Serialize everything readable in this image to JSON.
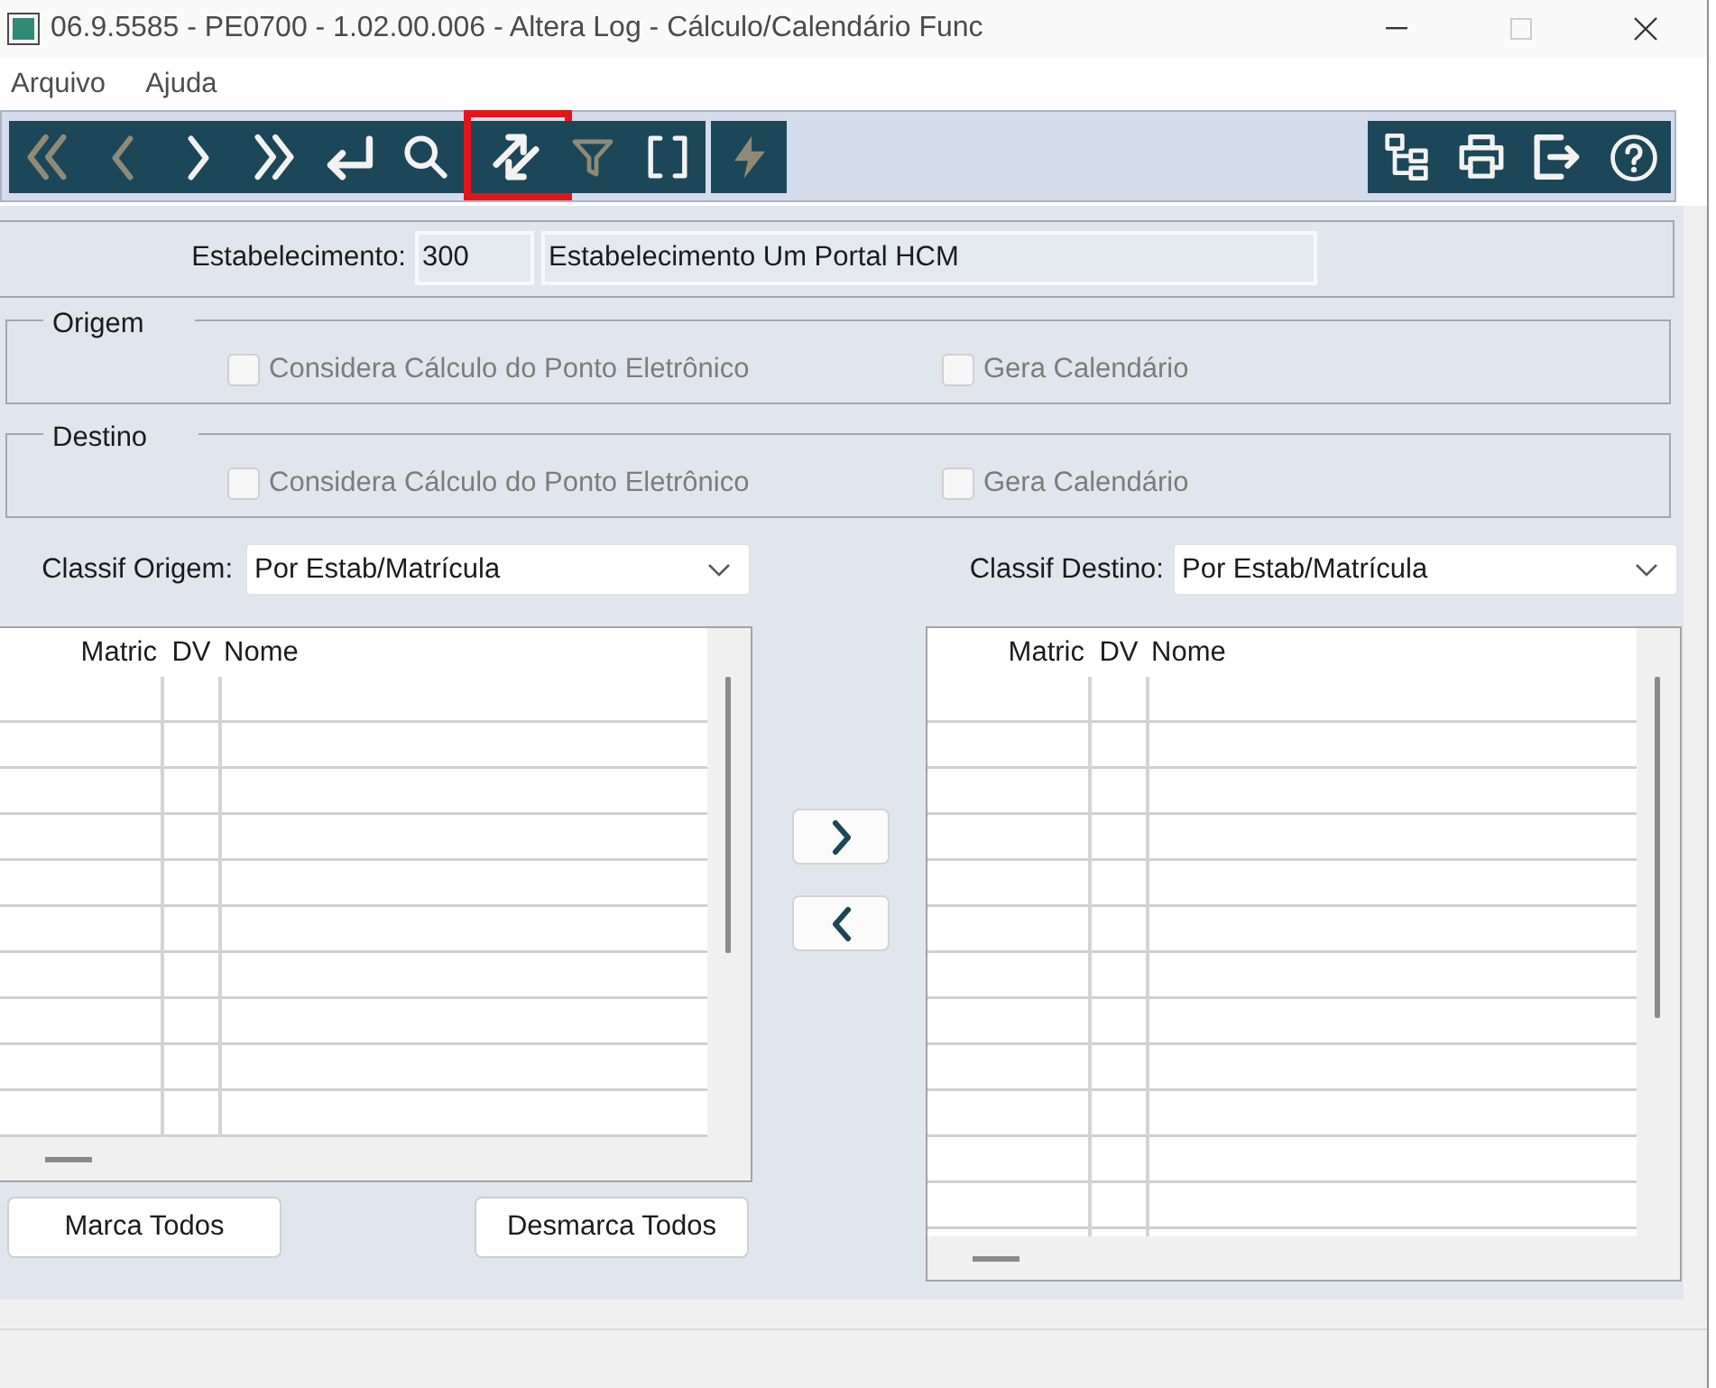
{
  "window": {
    "title": "06.9.5585 - PE0700 - 1.02.00.006 - Altera Log - Cálculo/Calendário Func",
    "controls": [
      {
        "kind": "minimize",
        "disabled": false
      },
      {
        "kind": "maximize",
        "disabled": true
      },
      {
        "kind": "close",
        "disabled": false
      }
    ]
  },
  "menu": [
    {
      "label": "Arquivo"
    },
    {
      "label": "Ajuda"
    }
  ],
  "toolbar": {
    "left_groups": [
      {
        "items": [
          {
            "kind": "first",
            "disabled": true,
            "highlighted": false
          },
          {
            "kind": "previous",
            "disabled": true,
            "highlighted": false
          },
          {
            "kind": "next",
            "disabled": false,
            "highlighted": false
          },
          {
            "kind": "last",
            "disabled": false,
            "highlighted": false
          },
          {
            "kind": "enter",
            "disabled": false,
            "highlighted": false
          },
          {
            "kind": "search",
            "disabled": false,
            "highlighted": false
          },
          {
            "kind": "refresh",
            "disabled": false,
            "highlighted": true
          },
          {
            "kind": "filter",
            "disabled": true,
            "highlighted": false
          },
          {
            "kind": "brackets",
            "disabled": false,
            "highlighted": false
          }
        ]
      },
      {
        "items": [
          {
            "kind": "lightning",
            "disabled": true,
            "highlighted": false
          }
        ]
      }
    ],
    "right_groups": [
      {
        "items": [
          {
            "kind": "tree",
            "disabled": false,
            "highlighted": false
          },
          {
            "kind": "print",
            "disabled": false,
            "highlighted": false
          },
          {
            "kind": "exit",
            "disabled": false,
            "highlighted": false
          },
          {
            "kind": "help",
            "disabled": false,
            "highlighted": false
          }
        ]
      }
    ]
  },
  "establishment": {
    "label": "Estabelecimento:",
    "code": "300",
    "name": "Estabelecimento Um Portal HCM",
    "disabled": true
  },
  "sections": [
    {
      "legend": "Origem",
      "options": [
        {
          "label": "Considera Cálculo do Ponto Eletrônico",
          "checked": false,
          "disabled": true
        },
        {
          "label": "Gera Calendário",
          "checked": false,
          "disabled": true
        }
      ]
    },
    {
      "legend": "Destino",
      "options": [
        {
          "label": "Considera Cálculo do Ponto Eletrônico",
          "checked": false,
          "disabled": true
        },
        {
          "label": "Gera Calendário",
          "checked": false,
          "disabled": true
        }
      ]
    }
  ],
  "lists": [
    {
      "label": "Classif Origem:",
      "sort": "Por Estab/Matrícula",
      "columns": [
        "Matric",
        "DV",
        "Nome"
      ],
      "buttons": [
        {
          "label": "Marca Todos"
        },
        {
          "label": "Desmarca Todos"
        }
      ]
    },
    {
      "label": "Classif Destino:",
      "sort": "Por Estab/Matrícula",
      "columns": [
        "Matric",
        "DV",
        "Nome"
      ]
    }
  ],
  "transfer_buttons": [
    {
      "kind": "forward"
    },
    {
      "kind": "back"
    }
  ]
}
